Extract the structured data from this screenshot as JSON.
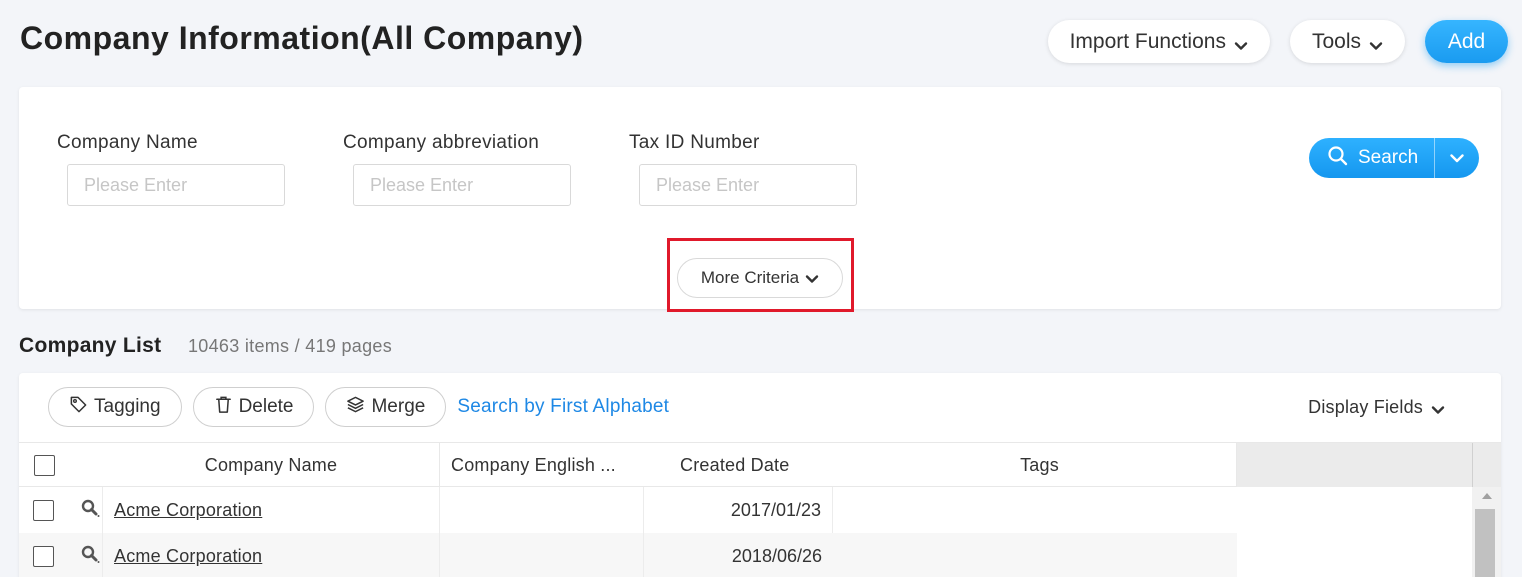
{
  "page": {
    "title": "Company Information(All Company)"
  },
  "top_actions": {
    "import_label": "Import Functions",
    "tools_label": "Tools",
    "add_label": "Add"
  },
  "filters": {
    "fields": [
      {
        "label": "Company Name",
        "placeholder": "Please Enter"
      },
      {
        "label": "Company abbreviation",
        "placeholder": "Please Enter"
      },
      {
        "label": "Tax ID Number",
        "placeholder": "Please Enter"
      }
    ],
    "search_label": "Search",
    "more_criteria_label": "More Criteria"
  },
  "list": {
    "title": "Company List",
    "count_text": "10463 items / 419 pages",
    "toolbar": {
      "tagging_label": "Tagging",
      "delete_label": "Delete",
      "merge_label": "Merge",
      "alphabet_link": "Search by First Alphabet",
      "display_fields_label": "Display Fields"
    },
    "columns": [
      "Company Name",
      "Company English ...",
      "Created Date",
      "Tags"
    ],
    "rows": [
      {
        "name": "Acme Corporation",
        "english_name": "",
        "created_date": "2017/01/23",
        "tags": ""
      },
      {
        "name": "Acme Corporation",
        "english_name": "",
        "created_date": "2018/06/26",
        "tags": ""
      }
    ]
  },
  "colors": {
    "accent": "#1a9bf0",
    "highlight_box": "#e0192b",
    "link": "#1e88e5",
    "background": "#f3f5f9"
  },
  "icons": [
    "chevron-down-icon",
    "search-icon",
    "tag-icon",
    "trash-icon",
    "layers-icon",
    "magnifier-icon"
  ]
}
